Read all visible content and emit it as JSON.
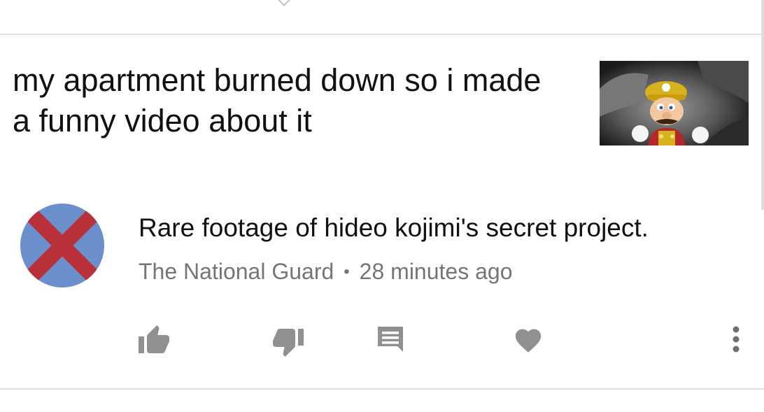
{
  "previous_card": {
    "chevron_icon": "chevron-down-icon"
  },
  "notification": {
    "video_title": "my apartment burned down so i made a funny video about it",
    "thumbnail": {
      "icon": "video-thumbnail",
      "background_color": "#1e1e1e"
    }
  },
  "comment": {
    "avatar": {
      "icon": "flag-avatar",
      "background_color": "#6b8fcb",
      "cross_color": "#b8303a"
    },
    "text": "Rare footage of hideo kojimi's secret project.",
    "author": "The National Guard",
    "separator": "•",
    "timestamp": "28 minutes ago"
  },
  "actions": {
    "like_icon": "thumbs-up-icon",
    "dislike_icon": "thumbs-down-icon",
    "reply_icon": "reply-comment-icon",
    "heart_icon": "heart-icon",
    "more_icon": "more-vertical-icon",
    "icon_color": "#909090"
  }
}
